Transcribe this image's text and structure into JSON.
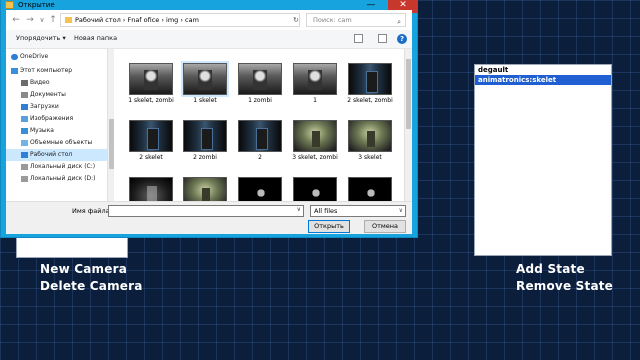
{
  "dialog": {
    "title": "Открытие",
    "title_buttons": {
      "minimize": "—",
      "close": "✕"
    },
    "nav": {
      "back": "←",
      "forward": "→",
      "dropdown": "∨",
      "up": "↑",
      "path": "Рабочий стол  ›  Fnaf ofice  ›  img  ›  cam",
      "search_placeholder": "Поиск: cam"
    },
    "toolbar": {
      "organize": "Упорядочить ▾",
      "new_folder": "Новая папка",
      "help": "?"
    },
    "sidebar": [
      {
        "label": "OneDrive",
        "icon": "cloud-icon"
      },
      {
        "label": "Этот компьютер",
        "icon": "computer-icon"
      },
      {
        "label": "Видео",
        "icon": "video-folder-icon"
      },
      {
        "label": "Документы",
        "icon": "documents-folder-icon"
      },
      {
        "label": "Загрузки",
        "icon": "downloads-folder-icon"
      },
      {
        "label": "Изображения",
        "icon": "pictures-folder-icon"
      },
      {
        "label": "Музыка",
        "icon": "music-folder-icon"
      },
      {
        "label": "Объемные объекты",
        "icon": "3d-objects-folder-icon"
      },
      {
        "label": "Рабочий стол",
        "icon": "desktop-folder-icon",
        "selected": true
      },
      {
        "label": "Локальный диск (C:)",
        "icon": "drive-icon"
      },
      {
        "label": "Локальный диск (D:)",
        "icon": "drive-icon"
      }
    ],
    "files": [
      {
        "name": "1 skelet, zombi",
        "kind": "room"
      },
      {
        "name": "1 skelet",
        "kind": "room",
        "selected": true
      },
      {
        "name": "1 zombi",
        "kind": "room"
      },
      {
        "name": "1",
        "kind": "room"
      },
      {
        "name": "2 skelet, zombi",
        "kind": "door"
      },
      {
        "name": "2 skelet",
        "kind": "door"
      },
      {
        "name": "2 zombi",
        "kind": "door"
      },
      {
        "name": "2",
        "kind": "door"
      },
      {
        "name": "3 skelet, zombi",
        "kind": "hall"
      },
      {
        "name": "3 skelet",
        "kind": "hall"
      },
      {
        "name": "",
        "kind": "dark"
      },
      {
        "name": "",
        "kind": "hall"
      },
      {
        "name": "",
        "kind": "hands"
      },
      {
        "name": "",
        "kind": "hands"
      },
      {
        "name": "",
        "kind": "hands"
      }
    ],
    "bottom": {
      "filename_label": "Имя файла:",
      "filename_value": "",
      "filter": "All files",
      "open": "Открыть",
      "cancel": "Отмена"
    }
  },
  "app": {
    "camera_actions": [
      "New Camera",
      "Delete Camera"
    ],
    "state_actions": [
      "Add State",
      "Remove State"
    ],
    "states": [
      {
        "label": "degault",
        "selected": false
      },
      {
        "label": "animatronics:skelet",
        "selected": true
      }
    ]
  }
}
